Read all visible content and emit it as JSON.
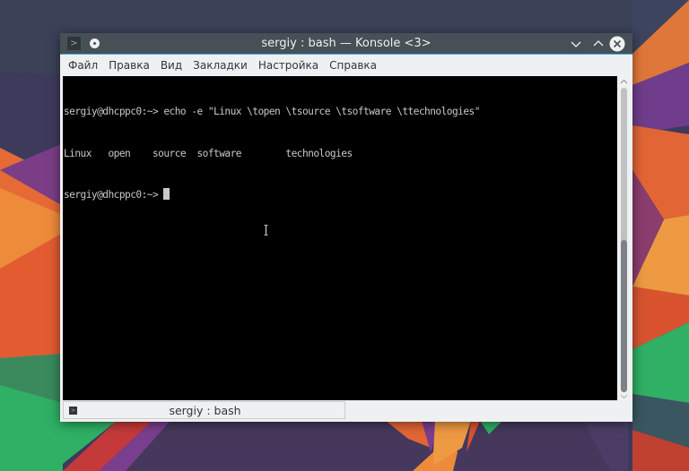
{
  "window": {
    "title": "sergiy : bash — Konsole <3>",
    "colors": {
      "titlebar": "#475057",
      "accent": "#3daee9",
      "chrome": "#eff0f1",
      "terminal_bg": "#000000",
      "terminal_fg": "#c8c8c8"
    },
    "buttons": {
      "app_menu": "terminal-icon",
      "pin": "pin-on-all-desktops-icon",
      "minimize": "chevron-down-icon",
      "maximize": "chevron-up-icon",
      "close": "close-icon"
    }
  },
  "menubar": {
    "items": [
      {
        "label": "Файл"
      },
      {
        "label": "Правка"
      },
      {
        "label": "Вид"
      },
      {
        "label": "Закладки"
      },
      {
        "label": "Настройка"
      },
      {
        "label": "Справка"
      }
    ]
  },
  "terminal": {
    "lines": [
      {
        "text": "sergiy@dhcppc0:~> echo -e \"Linux \\topen \\tsource \\tsoftware \\ttechnologies\""
      },
      {
        "text": "Linux   open    source  software        technologies"
      },
      {
        "text": "sergiy@dhcppc0:~> "
      }
    ],
    "prompt": "sergiy@dhcppc0:~> ",
    "cursor": "block"
  },
  "scrollbar": {
    "position_fraction": 1.0,
    "visible_fraction": 0.5
  },
  "tabs": [
    {
      "label": "sergiy : bash",
      "icon": "terminal-icon",
      "active": true
    }
  ]
}
